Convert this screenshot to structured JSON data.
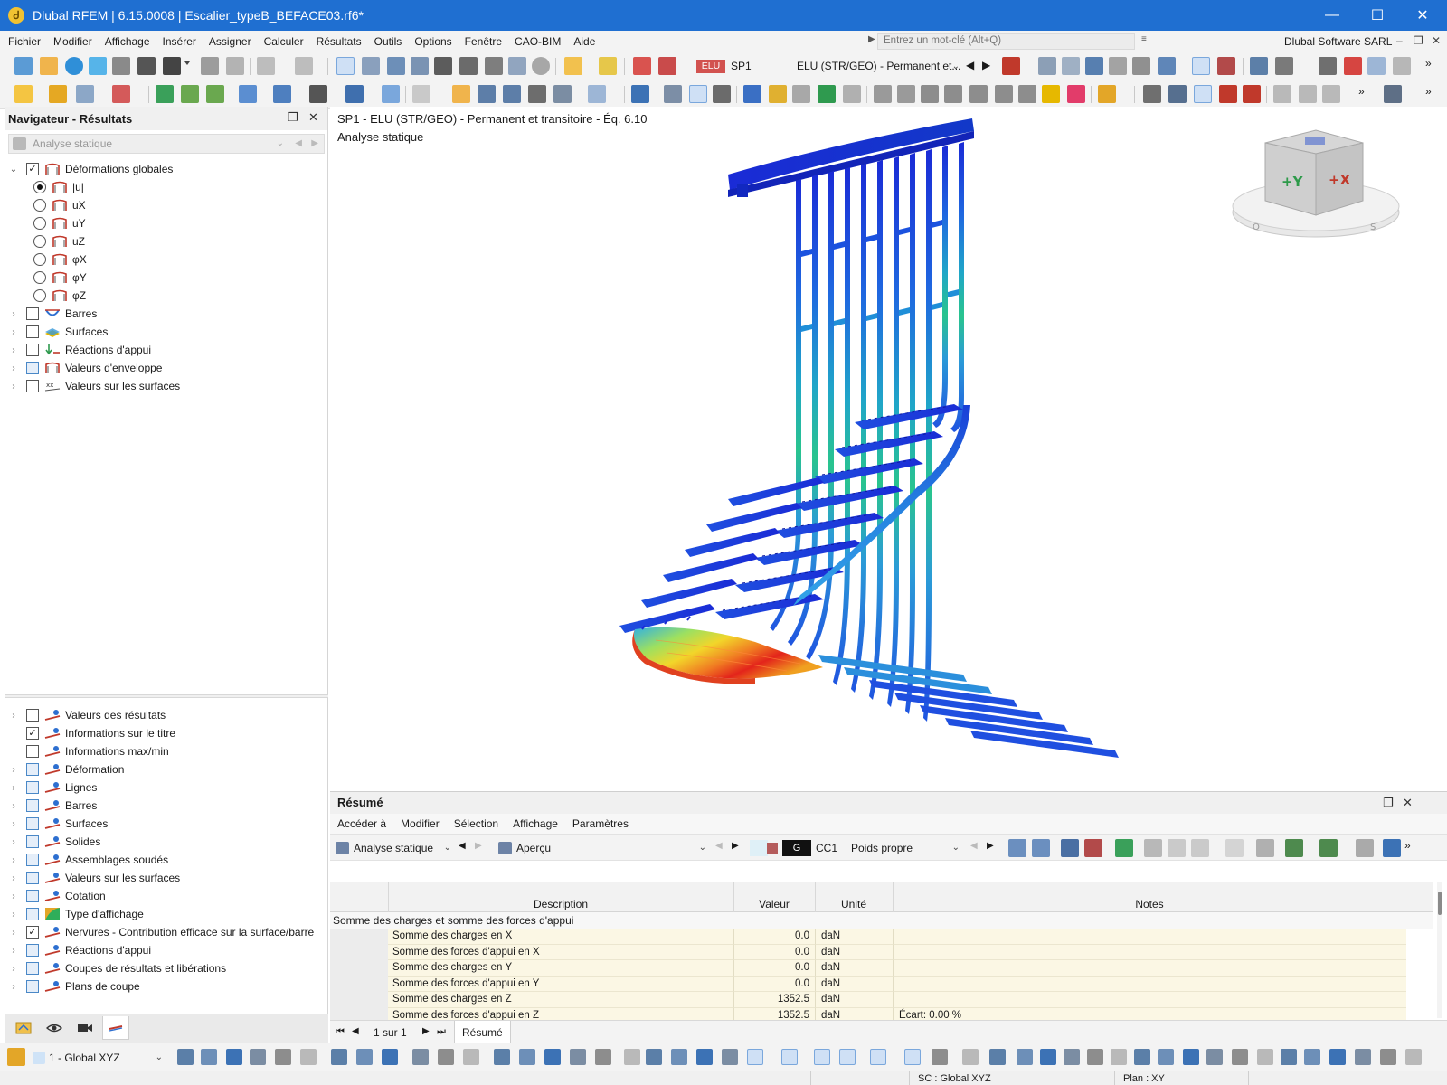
{
  "window": {
    "title": "Dlubal RFEM | 6.15.0008 | Escalier_typeB_BEFACE03.rf6*",
    "minimize": "—",
    "maximize": "☐",
    "close": "✕"
  },
  "menu": {
    "items": [
      "Fichier",
      "Modifier",
      "Affichage",
      "Insérer",
      "Assigner",
      "Calculer",
      "Résultats",
      "Outils",
      "Options",
      "Fenêtre",
      "CAO-BIM",
      "Aide"
    ],
    "search_placeholder": "Entrez un mot-clé (Alt+Q)",
    "company": "Dlubal Software SARL"
  },
  "toolbar": {
    "elu_badge": "ELU",
    "load_situation": "SP1",
    "combo_label": "ELU (STR/GEO) - Permanent et..."
  },
  "navigator": {
    "title": "Navigateur - Résultats",
    "analysis_combo": "Analyse statique",
    "tree_top": [
      {
        "label": "Déformations globales",
        "kind": "checkbox",
        "checked": true,
        "expanded": true,
        "level": 0
      },
      {
        "label": "|u|",
        "kind": "radio",
        "checked": true,
        "level": 1
      },
      {
        "label": "uX",
        "kind": "radio",
        "checked": false,
        "level": 1
      },
      {
        "label": "uY",
        "kind": "radio",
        "checked": false,
        "level": 1
      },
      {
        "label": "uZ",
        "kind": "radio",
        "checked": false,
        "level": 1
      },
      {
        "label": "φX",
        "kind": "radio",
        "checked": false,
        "level": 1
      },
      {
        "label": "φY",
        "kind": "radio",
        "checked": false,
        "level": 1
      },
      {
        "label": "φZ",
        "kind": "radio",
        "checked": false,
        "level": 1
      },
      {
        "label": "Barres",
        "kind": "checkbox",
        "checked": false,
        "level": 0
      },
      {
        "label": "Surfaces",
        "kind": "checkbox",
        "checked": false,
        "level": 0
      },
      {
        "label": "Réactions d'appui",
        "kind": "checkbox",
        "checked": false,
        "level": 0
      },
      {
        "label": "Valeurs d'enveloppe",
        "kind": "checkbox",
        "checked": false,
        "level": 0,
        "blue": true
      },
      {
        "label": "Valeurs sur les surfaces",
        "kind": "checkbox",
        "checked": false,
        "level": 0
      }
    ],
    "tree_bottom": [
      {
        "label": "Valeurs des résultats",
        "checked": false,
        "blue": false
      },
      {
        "label": "Informations sur le titre",
        "checked": true,
        "blue": false
      },
      {
        "label": "Informations max/min",
        "checked": false,
        "blue": false
      },
      {
        "label": "Déformation",
        "checked": false,
        "blue": true
      },
      {
        "label": "Lignes",
        "checked": false,
        "blue": true
      },
      {
        "label": "Barres",
        "checked": false,
        "blue": true
      },
      {
        "label": "Surfaces",
        "checked": false,
        "blue": true
      },
      {
        "label": "Solides",
        "checked": false,
        "blue": true
      },
      {
        "label": "Assemblages soudés",
        "checked": false,
        "blue": true
      },
      {
        "label": "Valeurs sur les surfaces",
        "checked": false,
        "blue": true
      },
      {
        "label": "Cotation",
        "checked": false,
        "blue": true
      },
      {
        "label": "Type d'affichage",
        "checked": false,
        "blue": true
      },
      {
        "label": "Nervures - Contribution efficace sur la surface/barre",
        "checked": true,
        "blue": false
      },
      {
        "label": "Réactions d'appui",
        "checked": false,
        "blue": true
      },
      {
        "label": "Coupes de résultats et libérations",
        "checked": false,
        "blue": true
      },
      {
        "label": "Plans de coupe",
        "checked": false,
        "blue": true
      }
    ]
  },
  "viewport": {
    "title_line1": "SP1 - ELU (STR/GEO) - Permanent et transitoire - Éq. 6.10",
    "title_line2": "Analyse statique",
    "cube_y": "+Y",
    "cube_x": "+X",
    "cube_o": "O",
    "cube_s": "S"
  },
  "summary": {
    "title": "Résumé",
    "menu": [
      "Accéder à",
      "Modifier",
      "Sélection",
      "Affichage",
      "Paramètres"
    ],
    "combo_analysis": "Analyse statique",
    "combo_view": "Aperçu",
    "load_case_code": "G",
    "load_case_id": "CC1",
    "load_case_name": "Poids propre",
    "columns": {
      "description": "Description",
      "value": "Valeur",
      "unit": "Unité",
      "notes": "Notes"
    },
    "group": "Somme des charges et somme des forces d'appui",
    "rows": [
      {
        "description": "Somme des charges en X",
        "value": "0.0",
        "unit": "daN",
        "notes": ""
      },
      {
        "description": "Somme des forces d'appui en X",
        "value": "0.0",
        "unit": "daN",
        "notes": ""
      },
      {
        "description": "Somme des charges en Y",
        "value": "0.0",
        "unit": "daN",
        "notes": ""
      },
      {
        "description": "Somme des forces d'appui en Y",
        "value": "0.0",
        "unit": "daN",
        "notes": ""
      },
      {
        "description": "Somme des charges en Z",
        "value": "1352.5",
        "unit": "daN",
        "notes": ""
      },
      {
        "description": "Somme des forces d'appui en Z",
        "value": "1352.5",
        "unit": "daN",
        "notes": "Écart: 0.00 %"
      }
    ],
    "pager": "1 sur 1",
    "tab": "Résumé"
  },
  "bottom": {
    "coord_system": "1 - Global XYZ",
    "status_cs": "SC : Global XYZ",
    "status_plane": "Plan : XY"
  },
  "colors": {
    "titlebar": "#1f6fd1",
    "elu_badge": "#d2524f",
    "table_row": "#fbf7e4"
  }
}
